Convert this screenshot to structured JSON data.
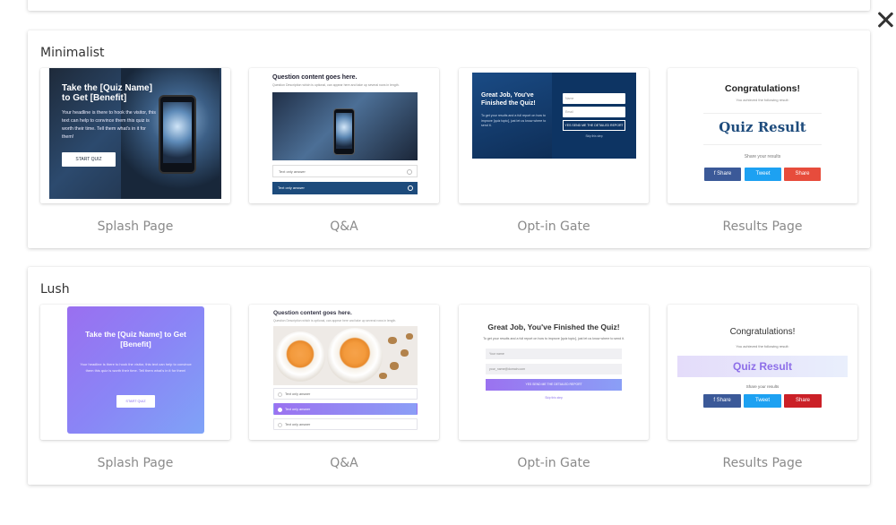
{
  "close_label": "×",
  "minimalist": {
    "title": "Minimalist",
    "captions": [
      "Splash Page",
      "Q&A",
      "Opt-in Gate",
      "Results Page"
    ],
    "splash": {
      "title": "Take the [Quiz Name] to Get [Benefit]",
      "text": "Your headline is there to hook the visitor, this text can help to convince them this quiz is worth their time. Tell them what's in it for them!",
      "button": "START QUIZ"
    },
    "qa": {
      "question": "Question content goes here.",
      "description": "Question Description which is optional, can appear here and take up several rows in length.",
      "answer1": "Text only answer",
      "answer2": "Text only answer"
    },
    "optin": {
      "title": "Great Job, You've Finished the Quiz!",
      "text": "To get your results and a full report on how to improve [quiz topic], just let us know where to send it.",
      "name_placeholder": "Name",
      "email_placeholder": "Email",
      "button": "YES SEND ME THE DETAILED REPORT",
      "skip": "Skip this step"
    },
    "results": {
      "congrats": "Congratulations!",
      "achieved": "You achieved the following result:",
      "result": "Quiz Result",
      "share_text": "Share your results",
      "facebook": "f  Share",
      "twitter": "Tweet",
      "pinterest": "Share"
    }
  },
  "lush": {
    "title": "Lush",
    "captions": [
      "Splash Page",
      "Q&A",
      "Opt-in Gate",
      "Results Page"
    ],
    "splash": {
      "title": "Take the [Quiz Name] to Get [Benefit]",
      "text": "Your headline is there to hook the visitor, this text can help to convince them this quiz is worth their time. Tell them what's in it for them!",
      "button": "START QUIZ"
    },
    "qa": {
      "question": "Question content goes here.",
      "description": "Question Description which is optional, can appear here and take up several rows in length.",
      "answer1": "Text only answer",
      "answer2": "Text only answer",
      "answer3": "Text only answer"
    },
    "optin": {
      "title": "Great Job, You've Finished the Quiz!",
      "text": "To get your results and a full report on how to improve [quiz topic], just let us know where to send it.",
      "name_placeholder": "Your name",
      "email_placeholder": "your_name@domain.com",
      "button": "YES SEND ME THE DETAILED REPORT",
      "skip": "Skip this step"
    },
    "results": {
      "congrats": "Congratulations!",
      "achieved": "You achieved the following result:",
      "result": "Quiz Result",
      "share_text": "Share your results",
      "facebook": "f  Share",
      "twitter": "Tweet",
      "pinterest": "Share"
    }
  },
  "colors": {
    "minimal_primary": "#1d4b7c",
    "lush_primary": "#9b72f0",
    "caption": "#8a8a8a",
    "facebook": "#3b5998",
    "twitter": "#1da1f2",
    "pinterest": "#e74c3c"
  }
}
